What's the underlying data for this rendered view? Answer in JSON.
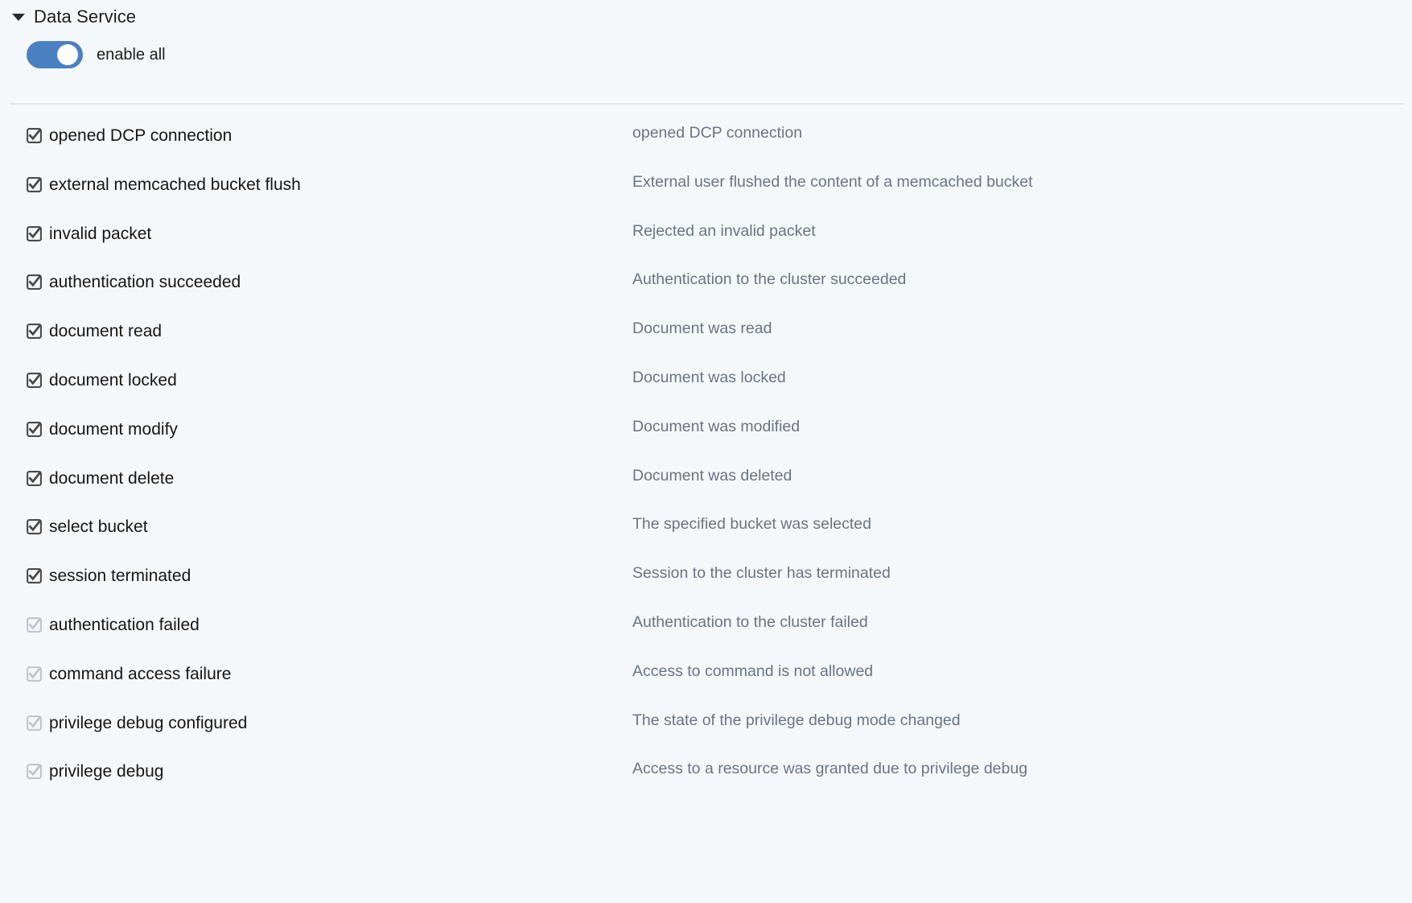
{
  "section": {
    "title": "Data Service",
    "caret_icon": "chevron-down-icon",
    "expanded": true
  },
  "enable_all": {
    "label": "enable all",
    "checked": true,
    "on_color": "#4a7fc1",
    "knob_color": "#ffffff"
  },
  "colors": {
    "background": "#f4f8fb",
    "divider": "#e2e6ea",
    "label_text": "#161616",
    "description_text": "#6b7480",
    "checkbox_enabled": "#4a4a4a",
    "checkbox_disabled": "#bfc6cd",
    "toggle_on": "#4a7fc1"
  },
  "events": [
    {
      "name": "opened DCP connection",
      "description": "opened DCP connection",
      "checked": true,
      "enabled": true
    },
    {
      "name": "external memcached bucket flush",
      "description": "External user flushed the content of a memcached bucket",
      "checked": true,
      "enabled": true
    },
    {
      "name": "invalid packet",
      "description": "Rejected an invalid packet",
      "checked": true,
      "enabled": true
    },
    {
      "name": "authentication succeeded",
      "description": "Authentication to the cluster succeeded",
      "checked": true,
      "enabled": true
    },
    {
      "name": "document read",
      "description": "Document was read",
      "checked": true,
      "enabled": true
    },
    {
      "name": "document locked",
      "description": "Document was locked",
      "checked": true,
      "enabled": true
    },
    {
      "name": "document modify",
      "description": "Document was modified",
      "checked": true,
      "enabled": true
    },
    {
      "name": "document delete",
      "description": "Document was deleted",
      "checked": true,
      "enabled": true
    },
    {
      "name": "select bucket",
      "description": "The specified bucket was selected",
      "checked": true,
      "enabled": true
    },
    {
      "name": "session terminated",
      "description": "Session to the cluster has terminated",
      "checked": true,
      "enabled": true
    },
    {
      "name": "authentication failed",
      "description": "Authentication to the cluster failed",
      "checked": true,
      "enabled": false
    },
    {
      "name": "command access failure",
      "description": "Access to command is not allowed",
      "checked": true,
      "enabled": false
    },
    {
      "name": "privilege debug configured",
      "description": "The state of the privilege debug mode changed",
      "checked": true,
      "enabled": false
    },
    {
      "name": "privilege debug",
      "description": "Access to a resource was granted due to privilege debug",
      "checked": true,
      "enabled": false
    }
  ]
}
